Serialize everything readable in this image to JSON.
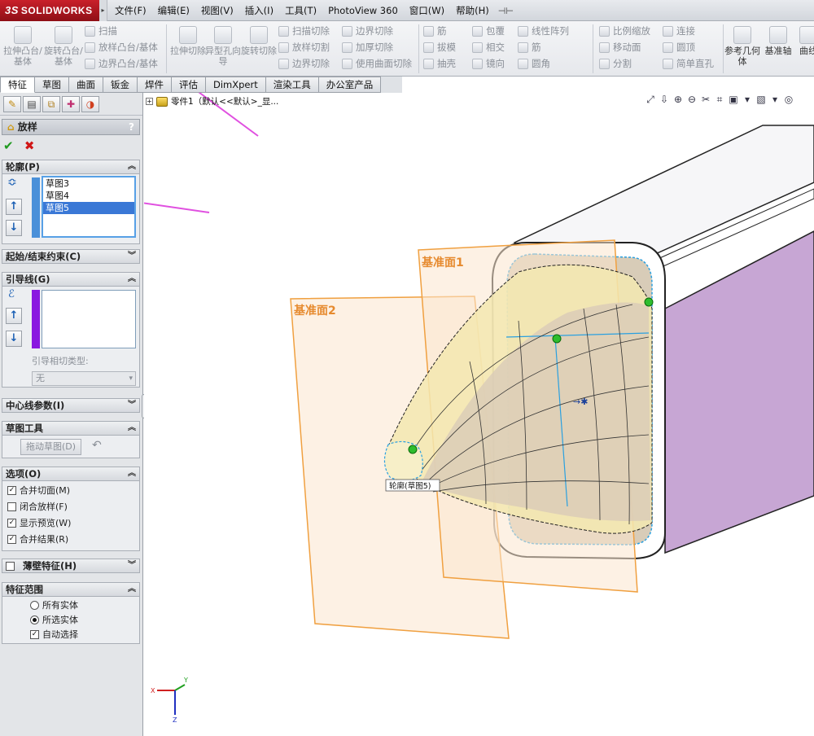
{
  "app": {
    "logo_text": "SOLIDWORKS",
    "logo_prefix": "3S"
  },
  "menu": [
    {
      "name": "file",
      "label": "文件(F)"
    },
    {
      "name": "edit",
      "label": "编辑(E)"
    },
    {
      "name": "view",
      "label": "视图(V)"
    },
    {
      "name": "insert",
      "label": "插入(I)"
    },
    {
      "name": "tools",
      "label": "工具(T)"
    },
    {
      "name": "photoview",
      "label": "PhotoView 360"
    },
    {
      "name": "window",
      "label": "窗口(W)"
    },
    {
      "name": "help",
      "label": "帮助(H)"
    }
  ],
  "ribbon": {
    "extrude_boss": "拉伸凸台/基体",
    "revolve_boss": "旋转凸台/基体",
    "sweep": "扫描",
    "loft_boss": "放样凸台/基体",
    "boundary_boss": "边界凸台/基体",
    "extrude_cut": "拉伸切除",
    "hole_wizard": "异型孔向导",
    "revolve_cut": "旋转切除",
    "swept_cut": "扫描切除",
    "lofted_cut": "放样切割",
    "boundary_cut": "边界切除",
    "boundary_cut2": "边界切除",
    "thicken_cut": "加厚切除",
    "surface_cut": "使用曲面切除",
    "rib": "筋",
    "draft": "拔模",
    "shell": "抽壳",
    "wrap": "包覆",
    "intersect": "相交",
    "mirror": "镜向",
    "linear_pattern": "线性阵列",
    "rib2": "筋",
    "fillet": "圆角",
    "scale": "比例缩放",
    "move_face": "移动面",
    "split": "分割",
    "connect": "连接",
    "dome": "圆顶",
    "simple_hole": "简单直孔",
    "ref_geometry": "参考几何体",
    "datum_axis": "基准轴",
    "curves": "曲线"
  },
  "tabs": [
    {
      "name": "features",
      "label": "特征",
      "active": true
    },
    {
      "name": "sketch",
      "label": "草图"
    },
    {
      "name": "surfaces",
      "label": "曲面"
    },
    {
      "name": "sheet-metal",
      "label": "钣金"
    },
    {
      "name": "weldments",
      "label": "焊件"
    },
    {
      "name": "evaluate",
      "label": "评估"
    },
    {
      "name": "dimxpert",
      "label": "DimXpert"
    },
    {
      "name": "render-tools",
      "label": "渲染工具"
    },
    {
      "name": "office",
      "label": "办公室产品"
    }
  ],
  "property_manager": {
    "title": "放样",
    "help": "?",
    "profiles": {
      "header": "轮廓(P)",
      "items": [
        "草图3",
        "草图4",
        "草图5"
      ],
      "selected_index": 2
    },
    "start_end": {
      "header": "起始/结束约束(C)"
    },
    "guides": {
      "header": "引导线(G)",
      "tangency_label": "引导相切类型:",
      "tangency_value": "无"
    },
    "centerline": {
      "header": "中心线参数(I)"
    },
    "sketch_tools": {
      "header": "草图工具",
      "drag_sketch": "拖动草图(D)"
    },
    "options": {
      "header": "选项(O)",
      "merge_tangent": {
        "label": "合并切面(M)",
        "checked": true
      },
      "close_loft": {
        "label": "闭合放样(F)",
        "checked": false
      },
      "show_preview": {
        "label": "显示预览(W)",
        "checked": true
      },
      "merge_result": {
        "label": "合并结果(R)",
        "checked": true
      }
    },
    "thin_feature": {
      "header": "薄壁特征(H)",
      "checked": false
    },
    "feature_scope": {
      "header": "特征范围",
      "all_bodies": "所有实体",
      "selected_bodies": "所选实体",
      "auto_select": "自动选择",
      "scope": "selected",
      "auto_checked": true
    }
  },
  "viewport": {
    "tree_text": "零件1（默认<<默认>_显...",
    "plane1_label": "基准面1",
    "plane2_label": "基准面2",
    "tooltip": "轮廓(草图5)",
    "axis_x": "X",
    "axis_y": "Y",
    "axis_z": "Z"
  },
  "colors": {
    "accent_red": "#c9202a",
    "plane_border": "#f0a040",
    "plane_label": "#e68a2e",
    "body_side": "#c9a8d6",
    "loft_surface": "#f3e7b0",
    "arrow_magenta": "#e050e0",
    "sketch_blue": "#2aa0e0"
  }
}
